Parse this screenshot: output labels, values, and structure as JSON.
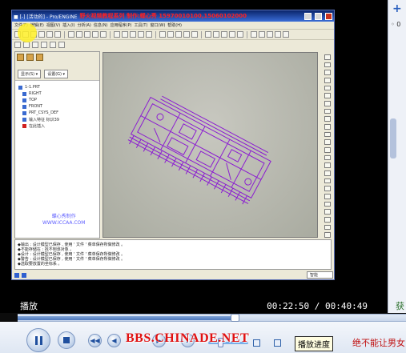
{
  "app": {
    "title_left": "■ [-] [活动的] - Pro/ENGINE",
    "title_red": "野火视频教程系列  制作:蝶心秀  15970010100,15060102000",
    "menu": [
      "文件(F)",
      "编辑(E)",
      "视图(V)",
      "插入(I)",
      "分析(A)",
      "信息(N)",
      "应用程序(P)",
      "工具(T)",
      "窗口(W)",
      "帮助(H)"
    ],
    "panel_dropdowns": [
      "显示(S) ▾",
      "设置(G) ▾"
    ],
    "tree": [
      {
        "label": "1-1.PRT",
        "icon": "part-icon"
      },
      {
        "label": "RIGHT",
        "icon": "datum-plane-icon"
      },
      {
        "label": "TOP",
        "icon": "datum-plane-icon"
      },
      {
        "label": "FRONT",
        "icon": "datum-plane-icon"
      },
      {
        "label": "PRT_CSYS_DEF",
        "icon": "csys-icon"
      },
      {
        "label": "输入特征 标识39",
        "icon": "import-feature-icon"
      },
      {
        "label": "在此插入",
        "icon": "insert-here-icon"
      }
    ],
    "watermark": [
      "蝶心秀制作",
      "WWW.ICCAA.COM"
    ],
    "messages": [
      "◆输出 : 设计模型已保存 , 使用 ' 文件 ' 菜单保存所做修改 。",
      "◆不能存储在 : 找不到该对象 。",
      "◆设计 : 设计模型已保存 , 使用 ' 文件 ' 菜单保存所做修改 。",
      "◆警告 : 设计模型已保存 , 使用 ' 文件 ' 菜单保存所做修改 。",
      "◆选取要放置的坐标系 。"
    ],
    "filter_label": "智能"
  },
  "player": {
    "status": "播放",
    "current_time": "00:22:50",
    "total_time": "00:40:49",
    "progress": 0.559,
    "watermark": "BBS.CHINADE.NET",
    "tooltip": "播放进度",
    "marquee": "绝不能让男女"
  },
  "side_panel": {
    "plus_label": "+",
    "item_text": "◦ 0",
    "bottom_text": "获"
  },
  "colors": {
    "model_stroke": "#8b1dd1",
    "title_red": "#ff2020",
    "player_accent": "#1f4f9e"
  }
}
